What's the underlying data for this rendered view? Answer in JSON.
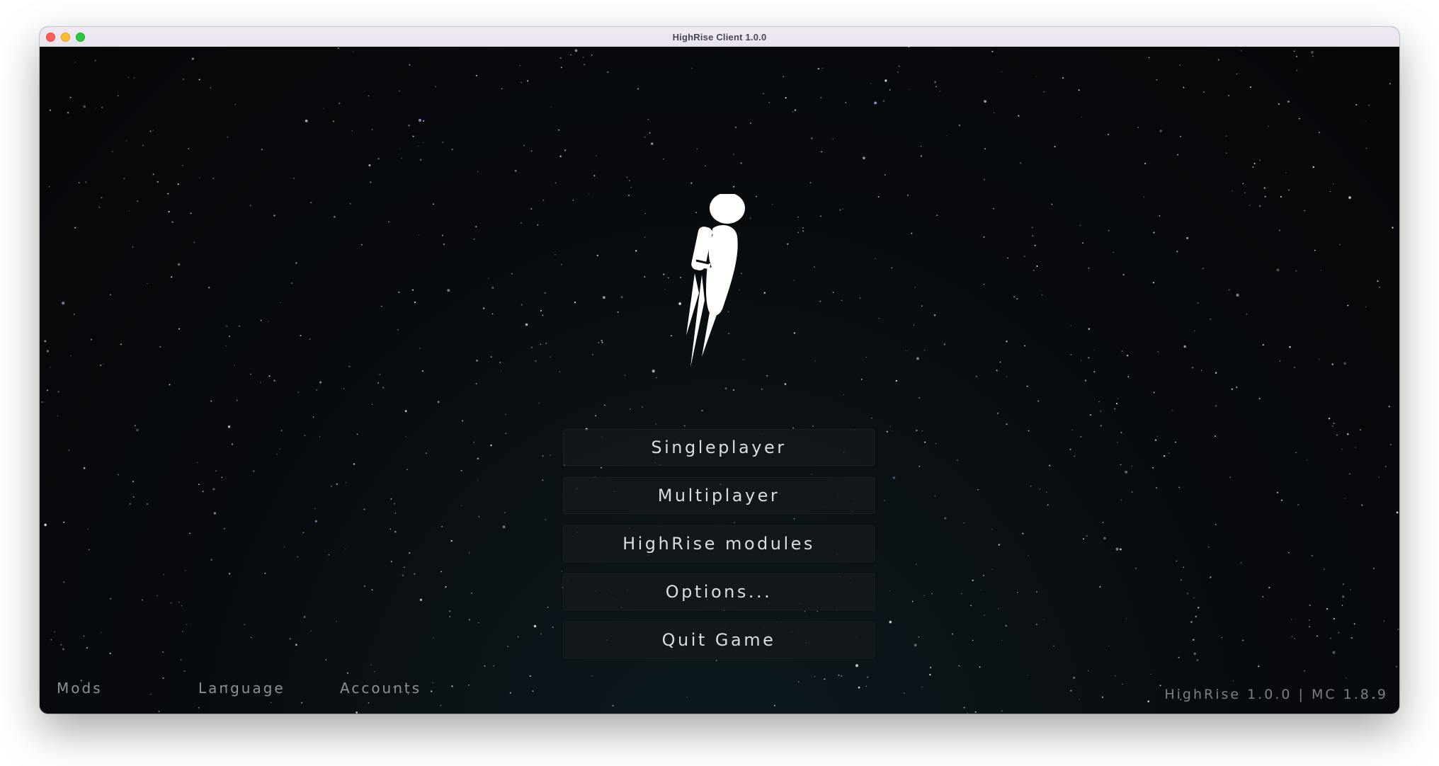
{
  "window": {
    "title": "HighRise Client 1.0.0"
  },
  "logo": {
    "icon": "jetpack-astronaut-icon"
  },
  "menu": {
    "items": [
      {
        "label": "Singleplayer"
      },
      {
        "label": "Multiplayer"
      },
      {
        "label": "HighRise modules"
      },
      {
        "label": "Options..."
      },
      {
        "label": "Quit Game"
      }
    ]
  },
  "footer": {
    "links": [
      {
        "label": "Mods"
      },
      {
        "label": "Language"
      },
      {
        "label": "Accounts"
      }
    ],
    "version": "HighRise 1.0.0 | MC 1.8.9"
  },
  "colors": {
    "background": "#0a0d10",
    "button": "#14181c",
    "button_text": "#dcdcdc",
    "link_text": "#8d9094"
  }
}
